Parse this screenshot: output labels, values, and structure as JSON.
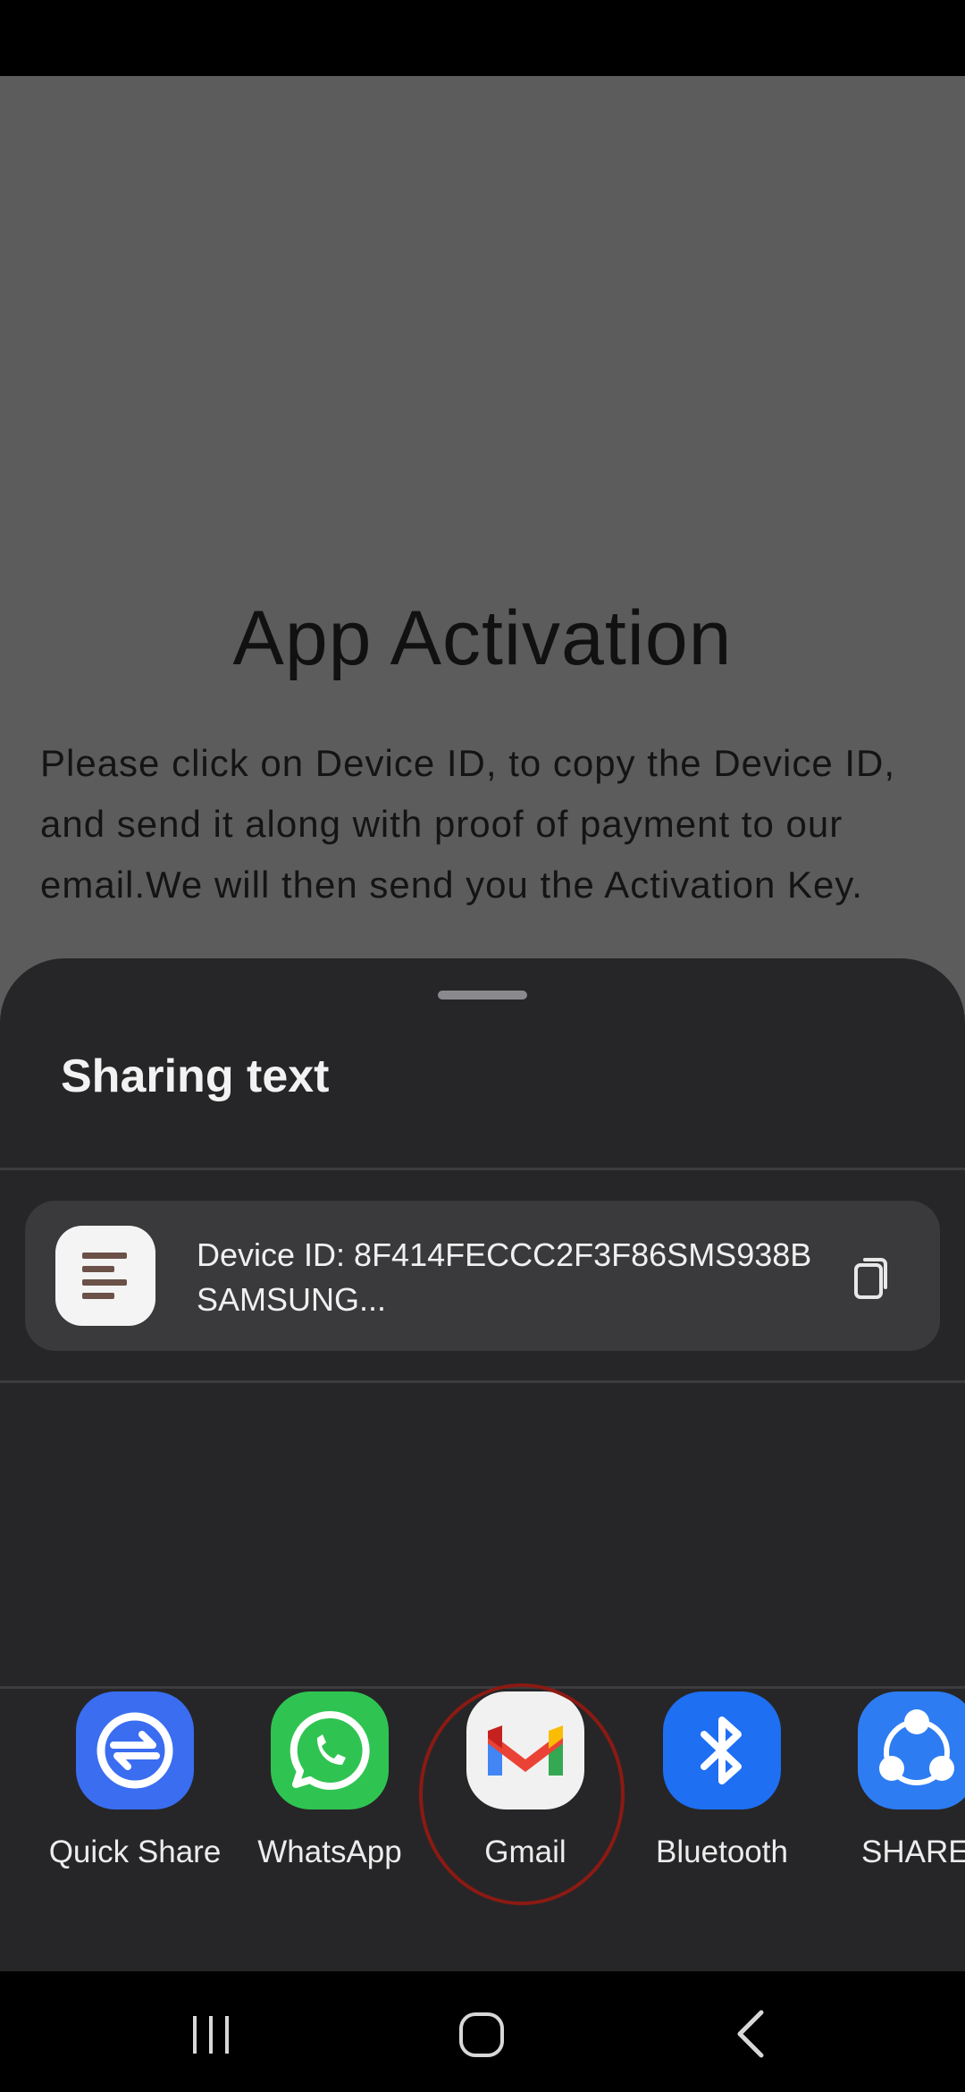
{
  "app": {
    "title": "App Activation",
    "description": "Please click on Device ID, to copy the Device ID, and send it along with proof of payment to our email.We will then send you the Activation Key."
  },
  "share_sheet": {
    "title": "Sharing text",
    "preview_text": "Device ID: 8F414FECCC2F3F86SMS938BSAMSUNG...",
    "copy_icon": "copy-icon",
    "targets": [
      {
        "label": "Quick Share",
        "icon": "quick-share-icon",
        "color": "#3a6df0"
      },
      {
        "label": "WhatsApp",
        "icon": "whatsapp-icon",
        "color": "#2fc451"
      },
      {
        "label": "Gmail",
        "icon": "gmail-icon",
        "color": "#f1f1f1"
      },
      {
        "label": "Bluetooth",
        "icon": "bluetooth-icon",
        "color": "#1e6ff2"
      },
      {
        "label": "SHAREit",
        "icon": "shareit-icon",
        "color": "#2e7cf2"
      }
    ]
  },
  "nav": {
    "recents_icon": "recents-icon",
    "home_icon": "home-icon",
    "back_icon": "back-icon"
  },
  "colors": {
    "sheet_bg": "#262628",
    "card_bg": "#3a3a3c",
    "highlight": "#8b1a13"
  }
}
